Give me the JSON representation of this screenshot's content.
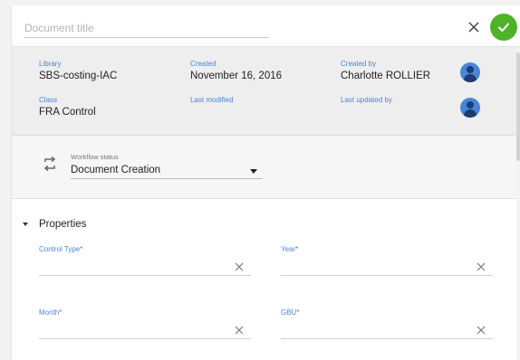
{
  "header": {
    "title_placeholder": "Document title",
    "close_icon": "close-icon",
    "confirm_icon": "check-icon",
    "confirm_color": "#4fb32a"
  },
  "metadata": {
    "library_label": "Library",
    "library_value": "SBS-costing-IAC",
    "created_label": "Created",
    "created_value": "November 16, 2016",
    "created_by_label": "Created by",
    "created_by_value": "Charlotte ROLLIER",
    "class_label": "Class",
    "class_value": "FRA Control",
    "last_modified_label": "Last modified",
    "last_updated_by_label": "Last updated by",
    "label_color": "#4a86d8"
  },
  "workflow": {
    "label": "Workflow status",
    "value": "Document Creation",
    "icon": "sync-icon"
  },
  "properties": {
    "title": "Properties",
    "expanded": true,
    "fields": [
      {
        "label": "Control Type*",
        "value": ""
      },
      {
        "label": "Year*",
        "value": ""
      },
      {
        "label": "Month*",
        "value": ""
      },
      {
        "label": "GBU*",
        "value": ""
      }
    ]
  }
}
